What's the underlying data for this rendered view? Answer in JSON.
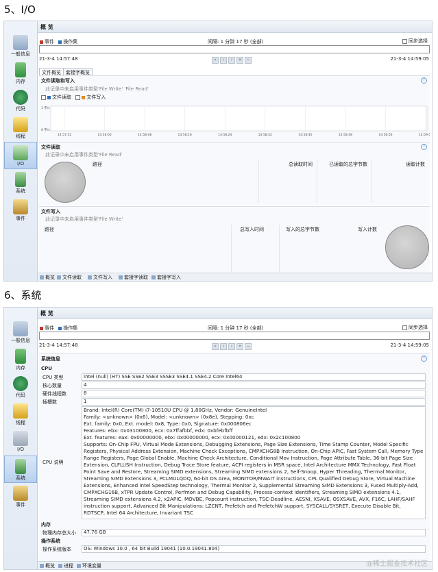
{
  "section5_heading": "5、I/O",
  "section6_heading": "6、系统",
  "watermark": "@稀土掘金技术社区",
  "sidebar": [
    {
      "label": "一般信息",
      "icon": "monitor-icon"
    },
    {
      "label": "内存",
      "icon": "memory-icon"
    },
    {
      "label": "代码",
      "icon": "code-icon"
    },
    {
      "label": "线程",
      "icon": "threads-icon"
    },
    {
      "label": "I/O",
      "icon": "io-icon"
    },
    {
      "label": "系统",
      "icon": "system-icon"
    },
    {
      "label": "事件",
      "icon": "events-icon"
    }
  ],
  "overview": {
    "title": "概 览",
    "legend_event": "事件",
    "legend_op_set": "操作集",
    "interval": "间隔: 1 分钟 17 秒 (全部)",
    "sync": "同步选择",
    "start_time": "21-3-4 14:57:48",
    "end_time": "21-3-4 14:59:05"
  },
  "io": {
    "tabs": [
      "文件概览",
      "套接字概览"
    ],
    "file_rw": {
      "title": "文件读取和写入",
      "note": "此记录中未启用事件类型'File Write' 'File Read'",
      "legend_read": "文件读取",
      "legend_write": "文件写入",
      "y_top": "1 字/s",
      "y_bottom": "0 字/s",
      "x_ticks": [
        "14:57:52",
        "14:58:00",
        "14:58:08",
        "14:58:16",
        "14:58:24",
        "14:58:32",
        "14:58:40",
        "14:58:48",
        "14:58:56",
        "14:59:04"
      ]
    },
    "file_read": {
      "title": "文件读取",
      "note": "此记录中未启用事件类型'File Read'",
      "cols": [
        "路径",
        "总读取时间",
        "已读取的总字节数",
        "读取计数"
      ]
    },
    "file_write": {
      "title": "文件写入",
      "note": "此记录中未启用事件类型'File Write'",
      "cols": [
        "路径",
        "总写入时间",
        "写入的总字节数",
        "写入计数"
      ]
    },
    "bottom_tabs": [
      "概览",
      "文件读取",
      "文件写入",
      "套接字读取",
      "套接字写入"
    ]
  },
  "system": {
    "section_title": "系统信息",
    "cpu_heading": "CPU",
    "cpu_type_label": "CPU 类型",
    "cpu_type": "Intel (null) (HT) SSE SSE2 SSE3 SSSE3 SSE4.1 SSE4.2 Core Intel64",
    "cores_label": "核心数量",
    "cores": "4",
    "hw_threads_label": "硬件线程数",
    "hw_threads": "8",
    "sockets_label": "插槽数",
    "sockets": "1",
    "cpu_desc_label": "CPU 说明",
    "cpu_desc": "Brand: Intel(R) Core(TM) i7-10510U CPU @ 1.80GHz, Vendor: GenuineIntel\nFamily: <unknown> (0x6), Model: <unknown> (0x8e), Stepping: 0xc\nExt. family: 0x0, Ext. model: 0x8, Type: 0x0, Signature: 0x000806ec\nFeatures: ebx: 0x03100800, ecx: 0x7ffafbbf, edx: 0xbfebfbff\nExt. features: eax: 0x00000000, ebx: 0x00000000, ecx: 0x00000121, edx: 0x2c100800\nSupports: On-Chip FPU, Virtual Mode Extensions, Debugging Extensions, Page Size Extensions, Time Stamp Counter, Model Specific Registers, Physical Address Extension, Machine Check Exceptions, CMPXCHG8B Instruction, On-Chip APIC, Fast System Call, Memory Type Range Registers, Page Global Enable, Machine Check Architecture, Conditional Mov Instruction, Page Attribute Table, 36-bit Page Size Extension, CLFLUSH Instruction, Debug Trace Store feature, ACPI registers in MSR space, Intel Architecture MMX Technology, Fast Float Point Save and Restore, Streaming SIMD extensions, Streaming SIMD extensions 2, Self-Snoop, Hyper Threading, Thermal Monitor, Streaming SIMD Extensions 3, PCLMULQDQ, 64-bit DS Area, MONITOR/MWAIT instructions, CPL Qualified Debug Store, Virtual Machine Extensions, Enhanced Intel SpeedStep technology, Thermal Monitor 2, Supplemental Streaming SIMD Extensions 3, Fused Multiply-Add, CMPXCHG16B, xTPR Update Control, Perfmon and Debug Capability, Process-context identifiers, Streaming SIMD extensions 4.1, Streaming SIMD extensions 4.2, x2APIC, MOVBE, Popcount instruction, TSC-Deadline, AESNI, XSAVE, OSXSAVE, AVX, F16C, LAHF/SAHF instruction support, Advanced Bit Manipulations: LZCNT, Prefetch and PrefetchW support, SYSCALL/SYSRET, Execute Disable Bit, RDTSCP, Intel 64 Architecture, Invariant TSC",
    "memory_heading": "内存",
    "phys_mem_label": "物理内存总大小",
    "phys_mem": "47.76 GB",
    "os_heading": "操作系统",
    "os_ver_label": "操作系统版本",
    "os_ver": "OS: Windows 10.0 , 64 bit Build 19041 (10.0.19041.804)",
    "bottom_tabs": [
      "概览",
      "进程",
      "环境变量"
    ]
  }
}
